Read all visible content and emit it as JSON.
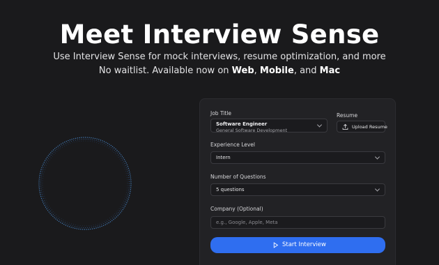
{
  "hero": {
    "title": "Meet Interview Sense",
    "subtitle": "Use Interview Sense for mock interviews, resume optimization, and more",
    "availability_prefix": "No waitlist. Available now on ",
    "platform_web": "Web",
    "sep1": ", ",
    "platform_mobile": "Mobile",
    "sep2": ", and ",
    "platform_mac": "Mac"
  },
  "form": {
    "job_title_label": "Job Title",
    "job_title_value": "Software Engineer",
    "job_title_category": "General Software Development",
    "resume_label": "Resume",
    "upload_resume_label": "Upload Resume",
    "experience_label": "Experience Level",
    "experience_value": "Intern",
    "questions_label": "Number of Questions",
    "questions_value": "5 questions",
    "company_label": "Company (Optional)",
    "company_value": "",
    "company_placeholder": "e.g., Google, Apple, Meta",
    "start_button_label": "Start Interview"
  },
  "icons": {
    "upload": "upload-icon",
    "chevron": "chevron-down-icon",
    "play": "play-icon"
  },
  "colors": {
    "background": "#1a1a1c",
    "panel": "#222225",
    "accent": "#2f6ef0",
    "ring": "#4a8fd8"
  }
}
